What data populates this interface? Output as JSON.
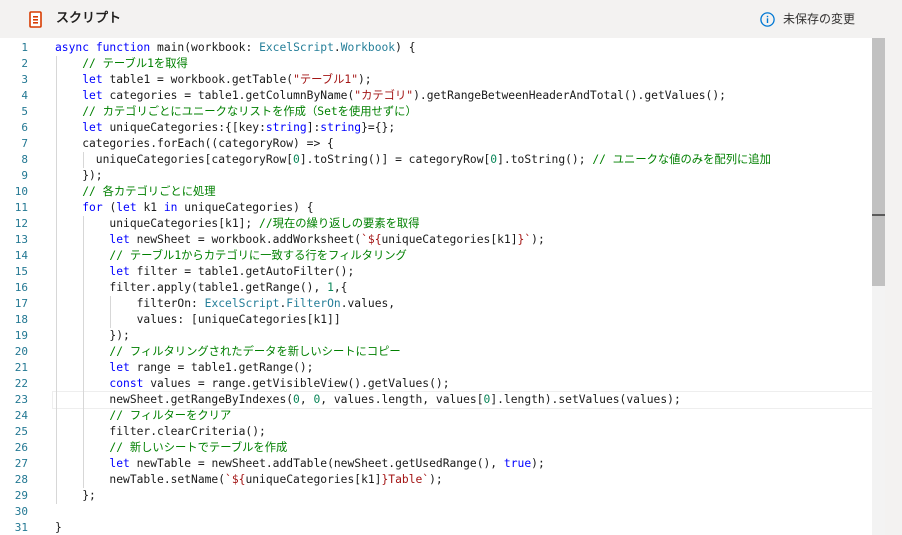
{
  "header": {
    "title": "スクリプト",
    "status": "未保存の変更",
    "title_icon": "script-icon",
    "status_icon": "info-icon"
  },
  "editor": {
    "current_line": 23,
    "lines": [
      [
        [
          "kw",
          "async "
        ],
        [
          "kw",
          "function "
        ],
        [
          "",
          "main(workbook: "
        ],
        [
          "ty",
          "ExcelScript"
        ],
        [
          "",
          "."
        ],
        [
          "ty",
          "Workbook"
        ],
        [
          "",
          ") {"
        ]
      ],
      [
        [
          "",
          "    "
        ],
        [
          "cm",
          "// テーブル1を取得"
        ]
      ],
      [
        [
          "",
          "    "
        ],
        [
          "kw",
          "let "
        ],
        [
          "",
          "table1 = workbook.getTable("
        ],
        [
          "str",
          "\"テーブル1\""
        ],
        [
          "",
          ");"
        ]
      ],
      [
        [
          "",
          "    "
        ],
        [
          "kw",
          "let "
        ],
        [
          "",
          "categories = table1.getColumnByName("
        ],
        [
          "str",
          "\"カテゴリ\""
        ],
        [
          "",
          ").getRangeBetweenHeaderAndTotal().getValues();"
        ]
      ],
      [
        [
          "",
          "    "
        ],
        [
          "cm",
          "// カテゴリごとにユニークなリストを作成（Setを使用せずに）"
        ]
      ],
      [
        [
          "",
          "    "
        ],
        [
          "kw",
          "let "
        ],
        [
          "",
          "uniqueCategories:{[key:"
        ],
        [
          "kw",
          "string"
        ],
        [
          "",
          "]:"
        ],
        [
          "kw",
          "string"
        ],
        [
          "",
          "}={};"
        ]
      ],
      [
        [
          "",
          "    categories.forEach((categoryRow) => {"
        ]
      ],
      [
        [
          "",
          "      uniqueCategories[categoryRow["
        ],
        [
          "nm",
          "0"
        ],
        [
          "",
          "].toString()] = categoryRow["
        ],
        [
          "nm",
          "0"
        ],
        [
          "",
          "].toString(); "
        ],
        [
          "cm",
          "// ユニークな値のみを配列に追加"
        ]
      ],
      [
        [
          "",
          "    });"
        ]
      ],
      [
        [
          "",
          "    "
        ],
        [
          "cm",
          "// 各カテゴリごとに処理"
        ]
      ],
      [
        [
          "",
          "    "
        ],
        [
          "kw",
          "for "
        ],
        [
          "",
          "("
        ],
        [
          "kw",
          "let "
        ],
        [
          "",
          "k1 "
        ],
        [
          "kw",
          "in "
        ],
        [
          "",
          "uniqueCategories) {"
        ]
      ],
      [
        [
          "",
          "        uniqueCategories[k1]; "
        ],
        [
          "cm",
          "//現在の繰り返しの要素を取得"
        ]
      ],
      [
        [
          "",
          "        "
        ],
        [
          "kw",
          "let "
        ],
        [
          "",
          "newSheet = workbook.addWorksheet("
        ],
        [
          "str",
          "`${"
        ],
        [
          "",
          "uniqueCategories[k1]"
        ],
        [
          "str",
          "}`"
        ],
        [
          "",
          ");"
        ]
      ],
      [
        [
          "",
          "        "
        ],
        [
          "cm",
          "// テーブル1からカテゴリに一致する行をフィルタリング"
        ]
      ],
      [
        [
          "",
          "        "
        ],
        [
          "kw",
          "let "
        ],
        [
          "",
          "filter = table1.getAutoFilter();"
        ]
      ],
      [
        [
          "",
          "        filter.apply(table1.getRange(), "
        ],
        [
          "nm",
          "1"
        ],
        [
          "",
          ",{"
        ]
      ],
      [
        [
          "",
          "            filterOn: "
        ],
        [
          "ty",
          "ExcelScript"
        ],
        [
          "",
          "."
        ],
        [
          "ty",
          "FilterOn"
        ],
        [
          "",
          ".values,"
        ]
      ],
      [
        [
          "",
          "            values: [uniqueCategories[k1]]"
        ]
      ],
      [
        [
          "",
          "        });"
        ]
      ],
      [
        [
          "",
          "        "
        ],
        [
          "cm",
          "// フィルタリングされたデータを新しいシートにコピー"
        ]
      ],
      [
        [
          "",
          "        "
        ],
        [
          "kw",
          "let "
        ],
        [
          "",
          "range = table1.getRange();"
        ]
      ],
      [
        [
          "",
          "        "
        ],
        [
          "kw",
          "const "
        ],
        [
          "",
          "values = range.getVisibleView().getValues();"
        ]
      ],
      [
        [
          "",
          "        newSheet.getRangeByIndexes("
        ],
        [
          "nm",
          "0"
        ],
        [
          "",
          ", "
        ],
        [
          "nm",
          "0"
        ],
        [
          "",
          ", values.length, values["
        ],
        [
          "nm",
          "0"
        ],
        [
          "",
          "].length).setValues(values);"
        ]
      ],
      [
        [
          "",
          "        "
        ],
        [
          "cm",
          "// フィルターをクリア"
        ]
      ],
      [
        [
          "",
          "        filter.clearCriteria();"
        ]
      ],
      [
        [
          "",
          "        "
        ],
        [
          "cm",
          "// 新しいシートでテーブルを作成"
        ]
      ],
      [
        [
          "",
          "        "
        ],
        [
          "kw",
          "let "
        ],
        [
          "",
          "newTable = newSheet.addTable(newSheet.getUsedRange(), "
        ],
        [
          "kw",
          "true"
        ],
        [
          "",
          ");"
        ]
      ],
      [
        [
          "",
          "        newTable.setName("
        ],
        [
          "str",
          "`${"
        ],
        [
          "",
          "uniqueCategories[k1]"
        ],
        [
          "str",
          "}Table`"
        ],
        [
          "",
          ");"
        ]
      ],
      [
        [
          "",
          "    };"
        ]
      ],
      [
        [
          "",
          ""
        ]
      ],
      [
        [
          "",
          "}"
        ]
      ]
    ]
  }
}
